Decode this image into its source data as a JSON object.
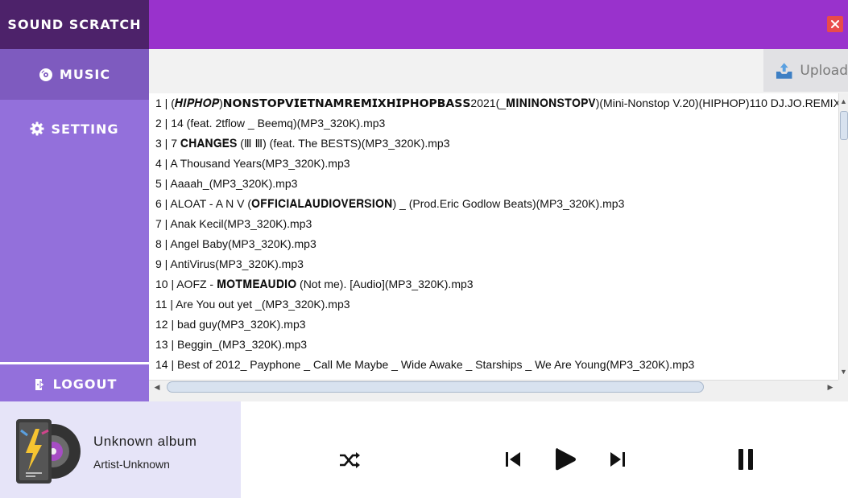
{
  "app": {
    "title": "SOUND SCRATCH"
  },
  "sidebar": {
    "items": [
      {
        "label": "MUSIC",
        "icon": "disc-icon"
      },
      {
        "label": "SETTING",
        "icon": "gear-icon"
      }
    ],
    "logout_label": "LOGOUT"
  },
  "toolbar": {
    "upload_label": "Upload"
  },
  "songs": [
    "1 | (𝑯𝑰𝑷𝑯𝑶𝑷)𝗡𝗢𝗡𝗦𝗧𝗢𝗣𝗩𝗜𝗘𝗧𝗡𝗔𝗠𝗥𝗘𝗠𝗜𝗫𝗛𝗜𝗣𝗛𝗢𝗣𝗕𝗔𝗦𝗦2021(_𝐌𝐈𝐍𝐈𝐍𝐎𝐍𝐒𝐓𝐎𝐏𝐕)(Mini-Nonstop V.20)(HIPHOP)110 DJ.JO.REMIX",
    "2 | 14 (feat. 2tflow _ Beemq)(MP3_320K).mp3",
    "3 | 7 𝐂𝐇𝐀𝐍𝐆𝐄𝐒 (Ⅲ Ⅲ) (feat. The BESTS)(MP3_320K).mp3",
    "4 | A Thousand Years(MP3_320K).mp3",
    "5 | Aaaah_(MP3_320K).mp3",
    "6 | ALOAT - A N V (𝐎𝐅𝐅𝐈𝐂𝐈𝐀𝐋𝐀𝐔𝐃𝐈𝐎𝐕𝐄𝐑𝐒𝐈𝐎𝐍) _ (Prod.Eric Godlow Beats)(MP3_320K).mp3",
    "7 | Anak Kecil(MP3_320K).mp3",
    "8 | Angel Baby(MP3_320K).mp3",
    "9 | AntiVirus(MP3_320K).mp3",
    "10 | AOFZ - 𝐌𝐎𝐓𝐌𝐄𝐀𝐔𝐃𝐈𝐎 (Not me). [Audio](MP3_320K).mp3",
    "11 | Are You out yet _(MP3_320K).mp3",
    "12 | bad guy(MP3_320K).mp3",
    "13 | Beggin_(MP3_320K).mp3",
    "14 | Best of 2012_ Payphone _ Call Me Maybe _ Wide Awake _ Starships _ We Are Young(MP3_320K).mp3"
  ],
  "player": {
    "album": "Unknown album",
    "artist": "Artist-Unknown"
  },
  "colors": {
    "header": "#9932cc",
    "brand": "#4d226a",
    "sidebar": "#9370db",
    "sidebar_active": "#7e5bbf",
    "player_info_bg": "#e6e4f8"
  }
}
